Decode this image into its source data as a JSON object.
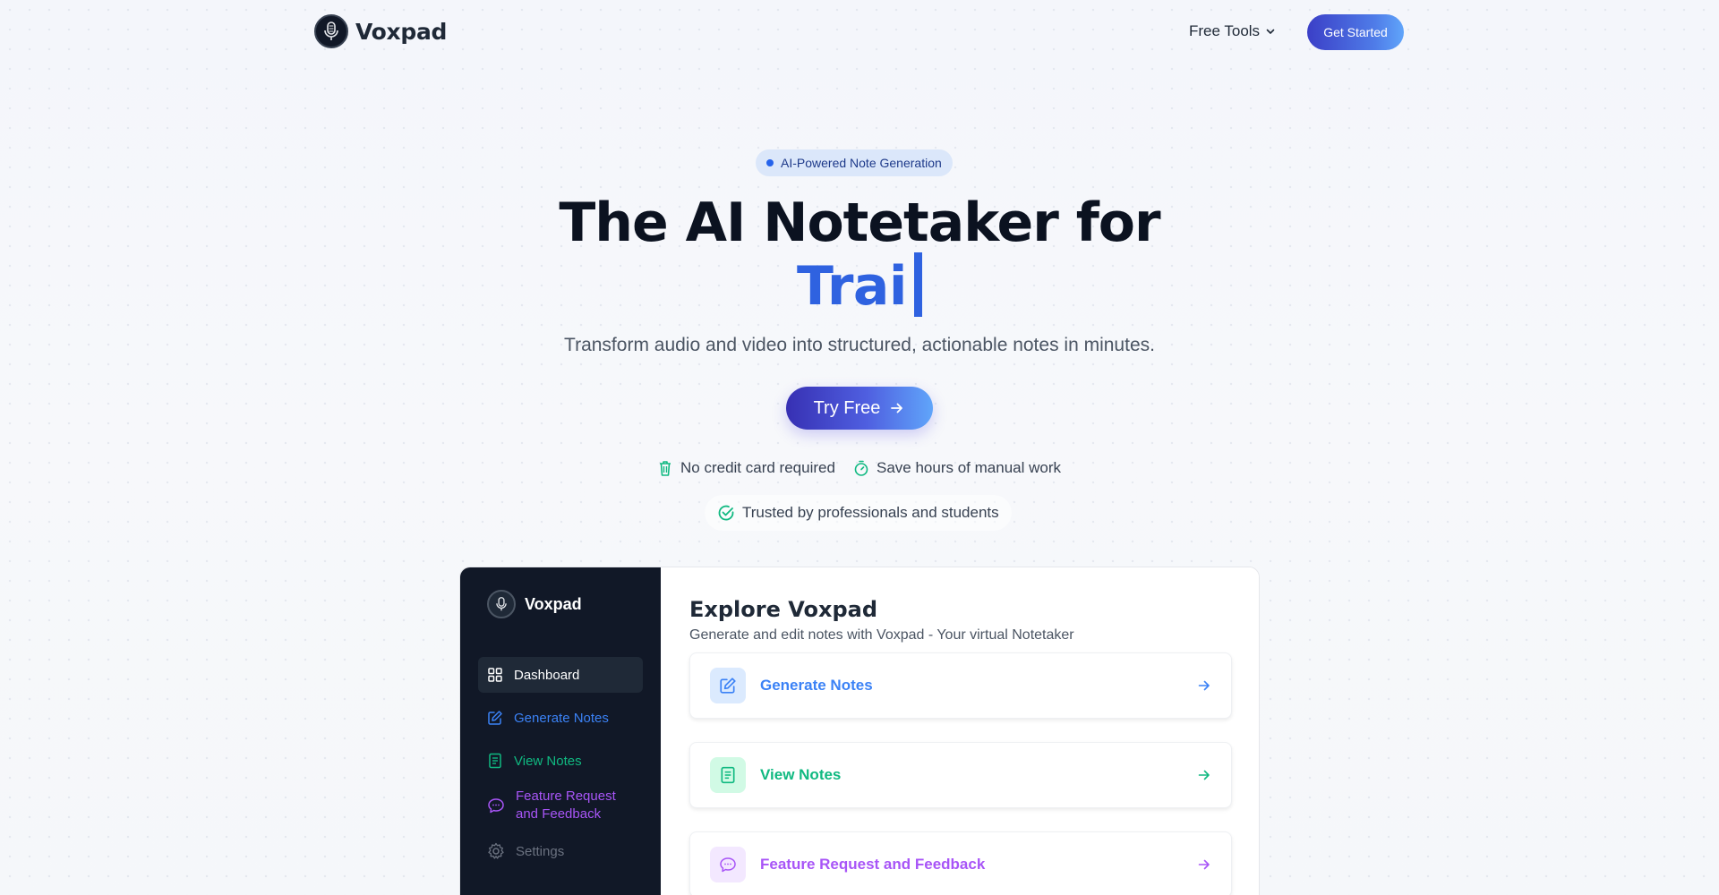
{
  "header": {
    "brand": "Voxpad",
    "free_tools": "Free Tools",
    "get_started": "Get Started"
  },
  "hero": {
    "badge": "AI-Powered Note Generation",
    "title_line1": "The AI Notetaker for",
    "title_line2": "Trai",
    "subtitle": "Transform audio and video into structured, actionable notes in minutes.",
    "cta": "Try Free",
    "features": [
      "No credit card required",
      "Save hours of manual work"
    ],
    "trusted": "Trusted by professionals and students"
  },
  "preview": {
    "brand": "Voxpad",
    "sidebar": [
      {
        "label": "Dashboard",
        "icon": "grid-icon",
        "color": "#ffffff"
      },
      {
        "label": "Generate Notes",
        "icon": "edit-icon",
        "color": "#3b82f6"
      },
      {
        "label": "View Notes",
        "icon": "document-icon",
        "color": "#10b981"
      },
      {
        "label": "Feature Request and Feedback",
        "icon": "chat-bubble-icon",
        "color": "#a855f7"
      },
      {
        "label": "Settings",
        "icon": "gear-icon",
        "color": "#6b7280"
      }
    ],
    "main_title": "Explore Voxpad",
    "main_subtitle": "Generate and edit notes with Voxpad - Your virtual Notetaker",
    "cards": [
      {
        "label": "Generate Notes",
        "icon": "edit-icon",
        "color": "#3b82f6"
      },
      {
        "label": "View Notes",
        "icon": "document-icon",
        "color": "#10b981"
      },
      {
        "label": "Feature Request and Feedback",
        "icon": "chat-bubble-icon",
        "color": "#a855f7"
      }
    ]
  },
  "colors": {
    "accent": "#2f62e0",
    "button_gradient_start": "#3730b3",
    "button_gradient_end": "#60a5fa",
    "sidebar_bg": "#111827"
  }
}
